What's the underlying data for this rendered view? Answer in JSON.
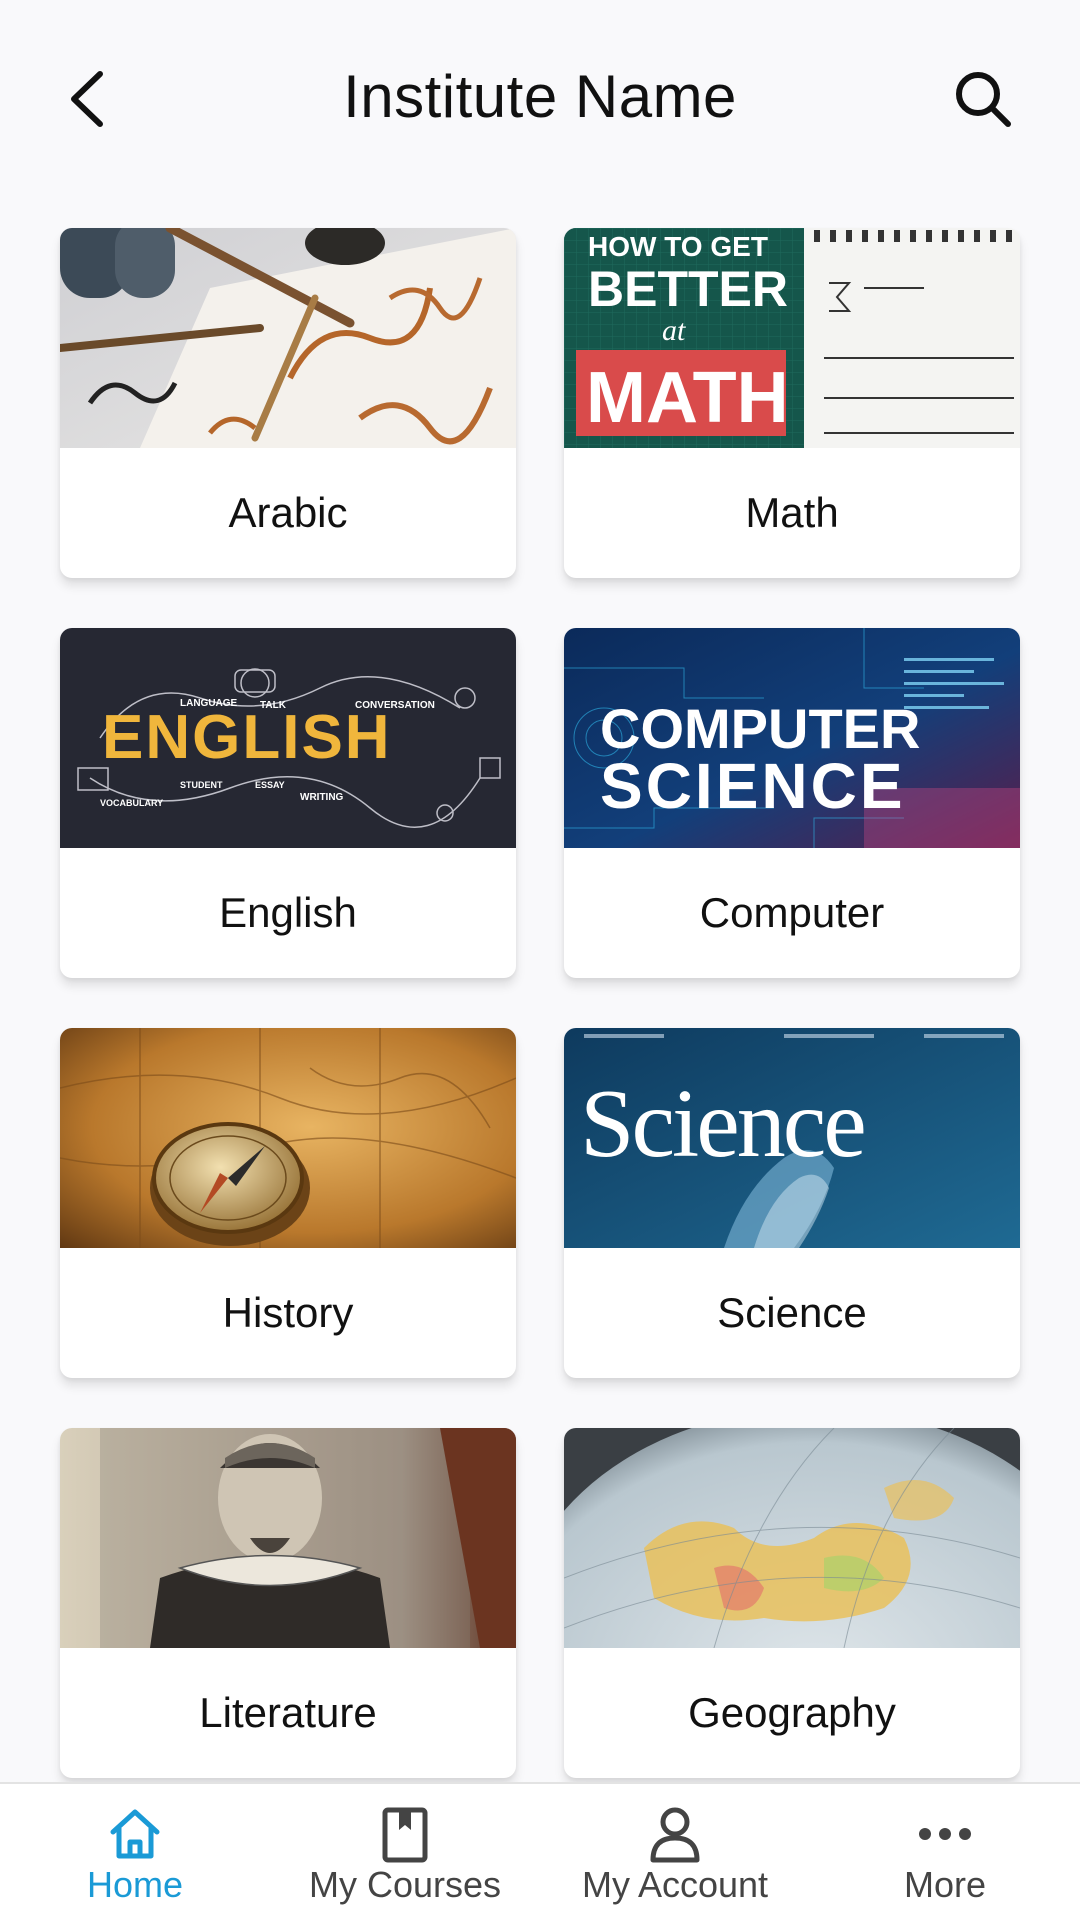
{
  "header": {
    "title": "Institute Name",
    "back_icon": "chevron-left-icon",
    "search_icon": "search-icon"
  },
  "courses": [
    {
      "label": "Arabic",
      "image": "arabic-calligraphy-image"
    },
    {
      "label": "Math",
      "image": "math-image",
      "image_text": [
        "HOW TO GET",
        "BETTER",
        "at",
        "MATH"
      ]
    },
    {
      "label": "English",
      "image": "english-image",
      "image_text": [
        "ENGLISH",
        "LANGUAGE",
        "TALK",
        "CONVERSATION",
        "VOCABULARY",
        "STUDENT",
        "ESSAY",
        "WRITING"
      ]
    },
    {
      "label": "Computer",
      "image": "computer-science-image",
      "image_text": [
        "COMPUTER",
        "SCIENCE"
      ]
    },
    {
      "label": "History",
      "image": "history-compass-map-image"
    },
    {
      "label": "Science",
      "image": "science-magazine-image",
      "image_text": [
        "Science"
      ]
    },
    {
      "label": "Literature",
      "image": "shakespeare-portrait-image"
    },
    {
      "label": "Geography",
      "image": "globe-image"
    }
  ],
  "bottom_nav": {
    "active_color": "#1a9ad6",
    "items": [
      {
        "label": "Home",
        "icon": "home-icon",
        "active": true
      },
      {
        "label": "My Courses",
        "icon": "book-icon",
        "active": false
      },
      {
        "label": "My Account",
        "icon": "user-icon",
        "active": false
      },
      {
        "label": "More",
        "icon": "more-icon",
        "active": false
      }
    ]
  }
}
